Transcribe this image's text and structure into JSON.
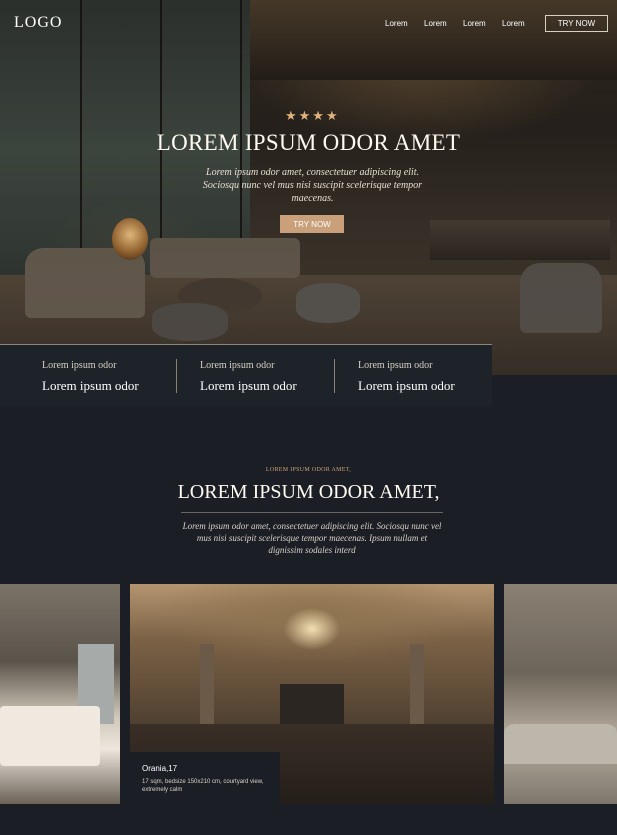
{
  "header": {
    "logo": "LOGO",
    "nav": [
      "Lorem",
      "Lorem",
      "Lorem",
      "Lorem"
    ],
    "cta": "TRY NOW"
  },
  "hero": {
    "stars": "★★★★",
    "title": "LOREM IPSUM ODOR AMET",
    "subtitle": "Lorem ipsum odor amet, consectetuer adipiscing elit. Sociosqu nunc vel mus nisi suscipit scelerisque tempor maecenas.",
    "cta": "TRY NOW"
  },
  "stats": [
    {
      "small": "Lorem ipsum odor",
      "big": "Lorem ipsum odor"
    },
    {
      "small": "Lorem ipsum odor",
      "big": "Lorem ipsum odor"
    },
    {
      "small": "Lorem ipsum odor",
      "big": "Lorem ipsum odor"
    }
  ],
  "intro": {
    "kicker": "LOREM IPSUM ODOR AMET,",
    "title": "LOREM IPSUM ODOR AMET,",
    "body": "Lorem ipsum odor amet, consectetuer adipiscing elit. Sociosqu nunc vel mus nisi suscipit scelerisque tempor maecenas. Ipsum nullam et dignissim sodales interd"
  },
  "gallery": {
    "featured": {
      "name": "Orania,17",
      "desc": "17 sqm, bedsize 150x210 cm, courtyard view, extremely calm"
    }
  },
  "colors": {
    "background": "#1b1f25",
    "accent": "#caa07a",
    "text": "#fffaf0"
  }
}
